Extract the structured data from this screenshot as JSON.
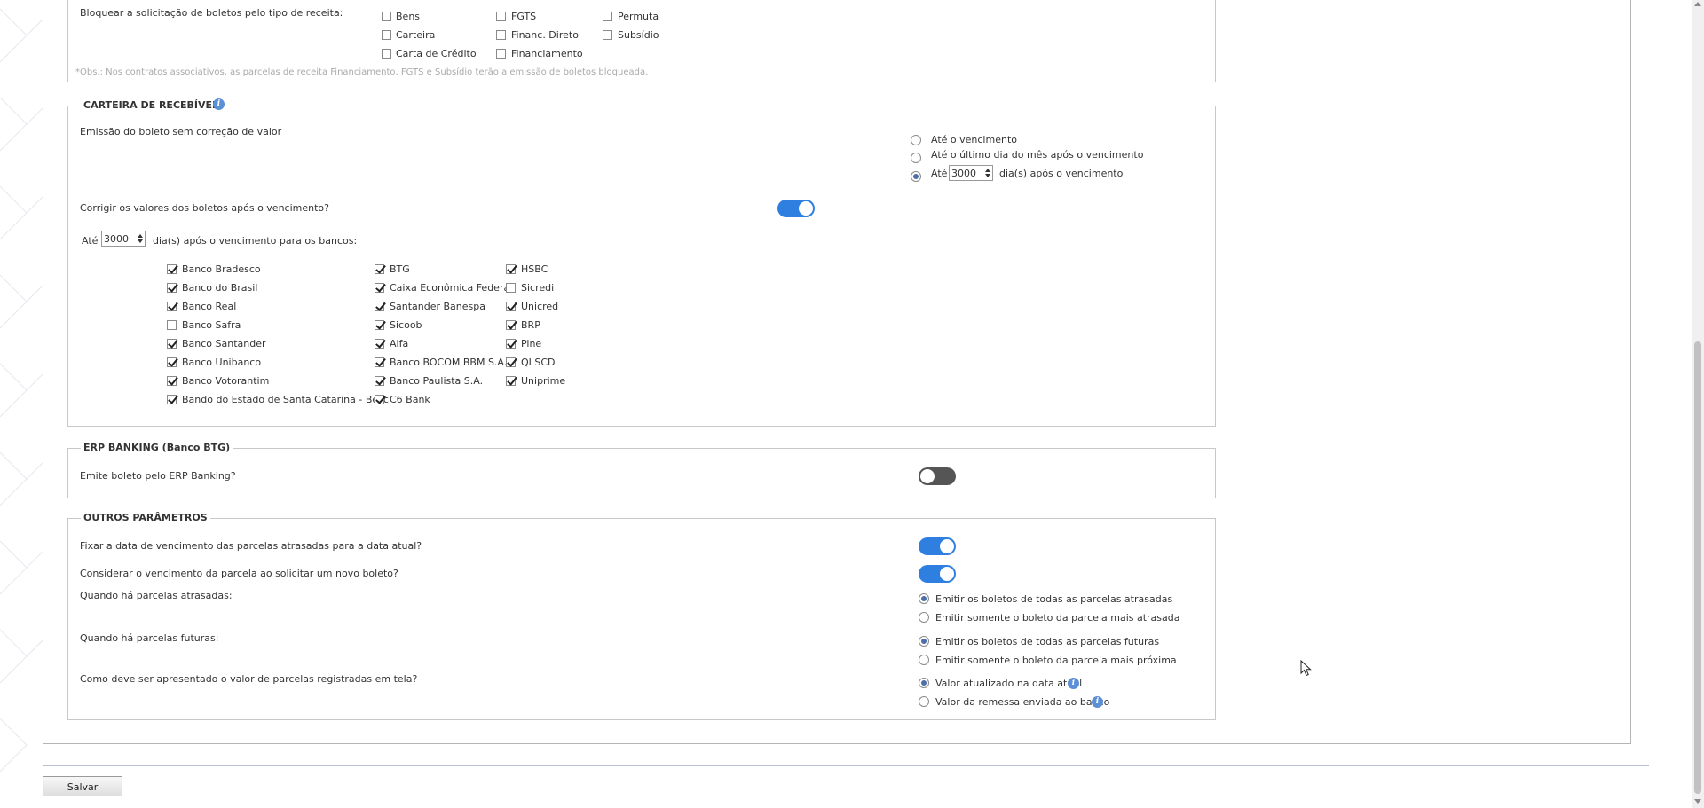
{
  "bloqueio": {
    "label": "Bloquear a solicitação de boletos pelo tipo de receita:",
    "tipos": [
      {
        "label": "Bens",
        "checked": false
      },
      {
        "label": "FGTS",
        "checked": false
      },
      {
        "label": "Permuta",
        "checked": false
      },
      {
        "label": "Carteira",
        "checked": false
      },
      {
        "label": "Financ. Direto",
        "checked": false
      },
      {
        "label": "Subsídio",
        "checked": false
      },
      {
        "label": "Carta de Crédito",
        "checked": false
      },
      {
        "label": "Financiamento",
        "checked": false
      }
    ],
    "obs": "*Obs.: Nos contratos associativos, as parcelas de receita Financiamento, FGTS e Subsídio terão a emissão de boletos bloqueada."
  },
  "carteira": {
    "legend": "CARTEIRA DE RECEBÍVEIS",
    "emissao_label": "Emissão do boleto sem correção de valor",
    "emissao_options": [
      {
        "label": "Até o vencimento",
        "checked": false
      },
      {
        "label": "Até o último dia do mês após o vencimento",
        "checked": false
      },
      {
        "label_pre": "Até",
        "value": "3000",
        "label_post": "dia(s) após o vencimento",
        "checked": true
      }
    ],
    "corrigir_label": "Corrigir os valores dos boletos após o vencimento?",
    "corrigir_on": true,
    "ate_label": "Até",
    "ate_value": "3000",
    "ate_post": "dia(s) após o vencimento para os bancos:",
    "bancos": [
      {
        "label": "Banco Bradesco",
        "checked": true
      },
      {
        "label": "Banco do Brasil",
        "checked": true
      },
      {
        "label": "Banco Real",
        "checked": true
      },
      {
        "label": "Banco Safra",
        "checked": false
      },
      {
        "label": "Banco Santander",
        "checked": true
      },
      {
        "label": "Banco Unibanco",
        "checked": true
      },
      {
        "label": "Banco Votorantim",
        "checked": true
      },
      {
        "label": "Bando do Estado de Santa Catarina - Besc",
        "checked": true
      },
      {
        "label": "BTG",
        "checked": true
      },
      {
        "label": "Caixa Econômica Federal",
        "checked": true
      },
      {
        "label": "Santander Banespa",
        "checked": true
      },
      {
        "label": "Sicoob",
        "checked": true
      },
      {
        "label": "Alfa",
        "checked": true
      },
      {
        "label": "Banco BOCOM BBM S.A.",
        "checked": true
      },
      {
        "label": "Banco Paulista S.A.",
        "checked": true
      },
      {
        "label": "C6 Bank",
        "checked": true
      },
      {
        "label": "HSBC",
        "checked": true
      },
      {
        "label": "Sicredi",
        "checked": false
      },
      {
        "label": "Unicred",
        "checked": true
      },
      {
        "label": "BRP",
        "checked": true
      },
      {
        "label": "Pine",
        "checked": true
      },
      {
        "label": "QI SCD",
        "checked": true
      },
      {
        "label": "Uniprime",
        "checked": true
      }
    ]
  },
  "erp": {
    "legend": "ERP BANKING (Banco BTG)",
    "emite_label": "Emite boleto pelo ERP Banking?",
    "emite_on": false
  },
  "outros": {
    "legend": "OUTROS PARÂMETROS",
    "fixar_label": "Fixar a data de vencimento das parcelas atrasadas para a data atual?",
    "fixar_on": true,
    "considerar_label": "Considerar o vencimento da parcela ao solicitar um novo boleto?",
    "considerar_on": true,
    "atrasadas_label": "Quando há parcelas atrasadas:",
    "atrasadas_options": [
      {
        "label": "Emitir os boletos de todas as parcelas atrasadas",
        "checked": true
      },
      {
        "label": "Emitir somente o boleto da parcela mais atrasada",
        "checked": false
      }
    ],
    "futuras_label": "Quando há parcelas futuras:",
    "futuras_options": [
      {
        "label": "Emitir os boletos de todas as parcelas futuras",
        "checked": true
      },
      {
        "label": "Emitir somente o boleto da parcela mais próxima",
        "checked": false
      }
    ],
    "valor_label": "Como deve ser apresentado o valor de parcelas registradas em tela?",
    "valor_options": [
      {
        "label": "Valor atualizado na data atual",
        "checked": true
      },
      {
        "label": "Valor da remessa enviada ao banco",
        "checked": false
      }
    ]
  },
  "save_label": "Salvar"
}
